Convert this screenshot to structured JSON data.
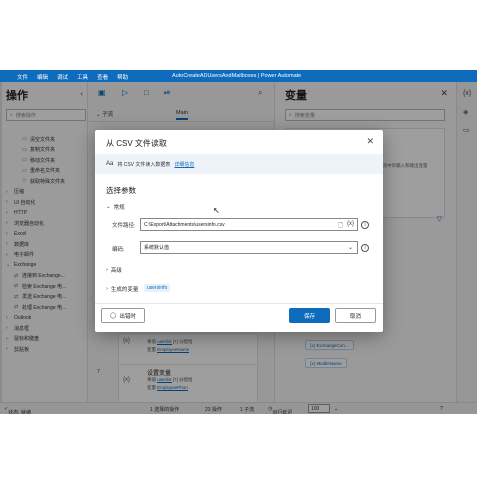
{
  "titlebar": {
    "menu": [
      "文件",
      "编辑",
      "调试",
      "工具",
      "查看",
      "帮助"
    ],
    "app_title": "AutoCreateADUsersAndMailboxes | Power Automate"
  },
  "actions_panel": {
    "title": "操作",
    "search_placeholder": "搜索操作",
    "tree": [
      {
        "label": "清空文件夹",
        "icon": "folder-icon",
        "level": "l1"
      },
      {
        "label": "复制文件夹",
        "icon": "folder-icon",
        "level": "l1"
      },
      {
        "label": "移动文件夹",
        "icon": "folder-icon",
        "level": "l1"
      },
      {
        "label": "重命名文件夹",
        "icon": "folder-icon",
        "level": "l1"
      },
      {
        "label": "获取特殊文件夹",
        "icon": "star-icon",
        "level": "l1"
      },
      {
        "label": "压缩",
        "icon": "chevron-right-icon",
        "level": "l0"
      },
      {
        "label": "UI 自动化",
        "icon": "chevron-right-icon",
        "level": "l0"
      },
      {
        "label": "HTTP",
        "icon": "chevron-right-icon",
        "level": "l0"
      },
      {
        "label": "浏览器自动化",
        "icon": "chevron-right-icon",
        "level": "l0"
      },
      {
        "label": "Excel",
        "icon": "chevron-right-icon",
        "level": "l0"
      },
      {
        "label": "数据库",
        "icon": "chevron-right-icon",
        "level": "l0"
      },
      {
        "label": "电子邮件",
        "icon": "chevron-right-icon",
        "level": "l0"
      },
      {
        "label": "Exchange",
        "icon": "chevron-down-icon",
        "level": "l0"
      },
      {
        "label": "连接到 Exchange...",
        "icon": "exchange-icon",
        "level": "l1b"
      },
      {
        "label": "检索 Exchange 电...",
        "icon": "exchange-icon",
        "level": "l1b"
      },
      {
        "label": "发送 Exchange 电...",
        "icon": "exchange-icon",
        "level": "l1b"
      },
      {
        "label": "处理 Exchange 电...",
        "icon": "exchange-icon",
        "level": "l1b"
      },
      {
        "label": "Outlook",
        "icon": "chevron-right-icon",
        "level": "l0"
      },
      {
        "label": "消息框",
        "icon": "chevron-right-icon",
        "level": "l0"
      },
      {
        "label": "鼠标和键盘",
        "icon": "chevron-right-icon",
        "level": "l0"
      },
      {
        "label": "剪贴板",
        "icon": "chevron-right-icon",
        "level": "l0"
      }
    ]
  },
  "canvas": {
    "subtabs": [
      "子流",
      "Main"
    ],
    "steps": [
      {
        "num": "",
        "title": "",
        "line1_prefix": "{x}",
        "line1_label": "将值",
        "line1_var": "userlist",
        "line1_mid": "[7] 分配给",
        "line2_label": "变量",
        "line2_var": "EmployeeName"
      },
      {
        "num": "7",
        "title": "设置变量",
        "line1_prefix": "{x}",
        "line1_label": "将值",
        "line1_var": "userlist",
        "line1_mid": "[7] 分配给",
        "line2_label": "变量",
        "line2_var": "EmployeePhon"
      }
    ]
  },
  "variables_panel": {
    "title": "变量",
    "search_placeholder": "搜索变量",
    "snippet_text": "此流中的输入和输出变量",
    "chips": [
      "ExchangeCon...",
      "MiddleName"
    ]
  },
  "statusbar": {
    "status": "状态: 就绪",
    "selected": "1 选择的操作",
    "actions_count": "23 操作",
    "subflows": "1 子流",
    "run_delay_label": "运行延迟",
    "run_delay_value": "100"
  },
  "dialog": {
    "title": "从 CSV 文件读取",
    "description": "将 CSV 文件读入数据表",
    "description_link": "详细信息",
    "section_title": "选择参数",
    "general_label": "常规",
    "file_path_label": "文件路径:",
    "file_path_value": "C:\\Export\\Attachments\\usersinfo.csv",
    "encoding_label": "编码:",
    "encoding_value": "系统默认值",
    "advanced_label": "高级",
    "generated_vars_label": "生成的变量",
    "generated_var": "usersinfo",
    "on_error_label": "出错时",
    "save_label": "保存",
    "cancel_label": "取消"
  },
  "colors": {
    "titlebar": "#0f6cbd",
    "accent": "#0f6cbd"
  }
}
